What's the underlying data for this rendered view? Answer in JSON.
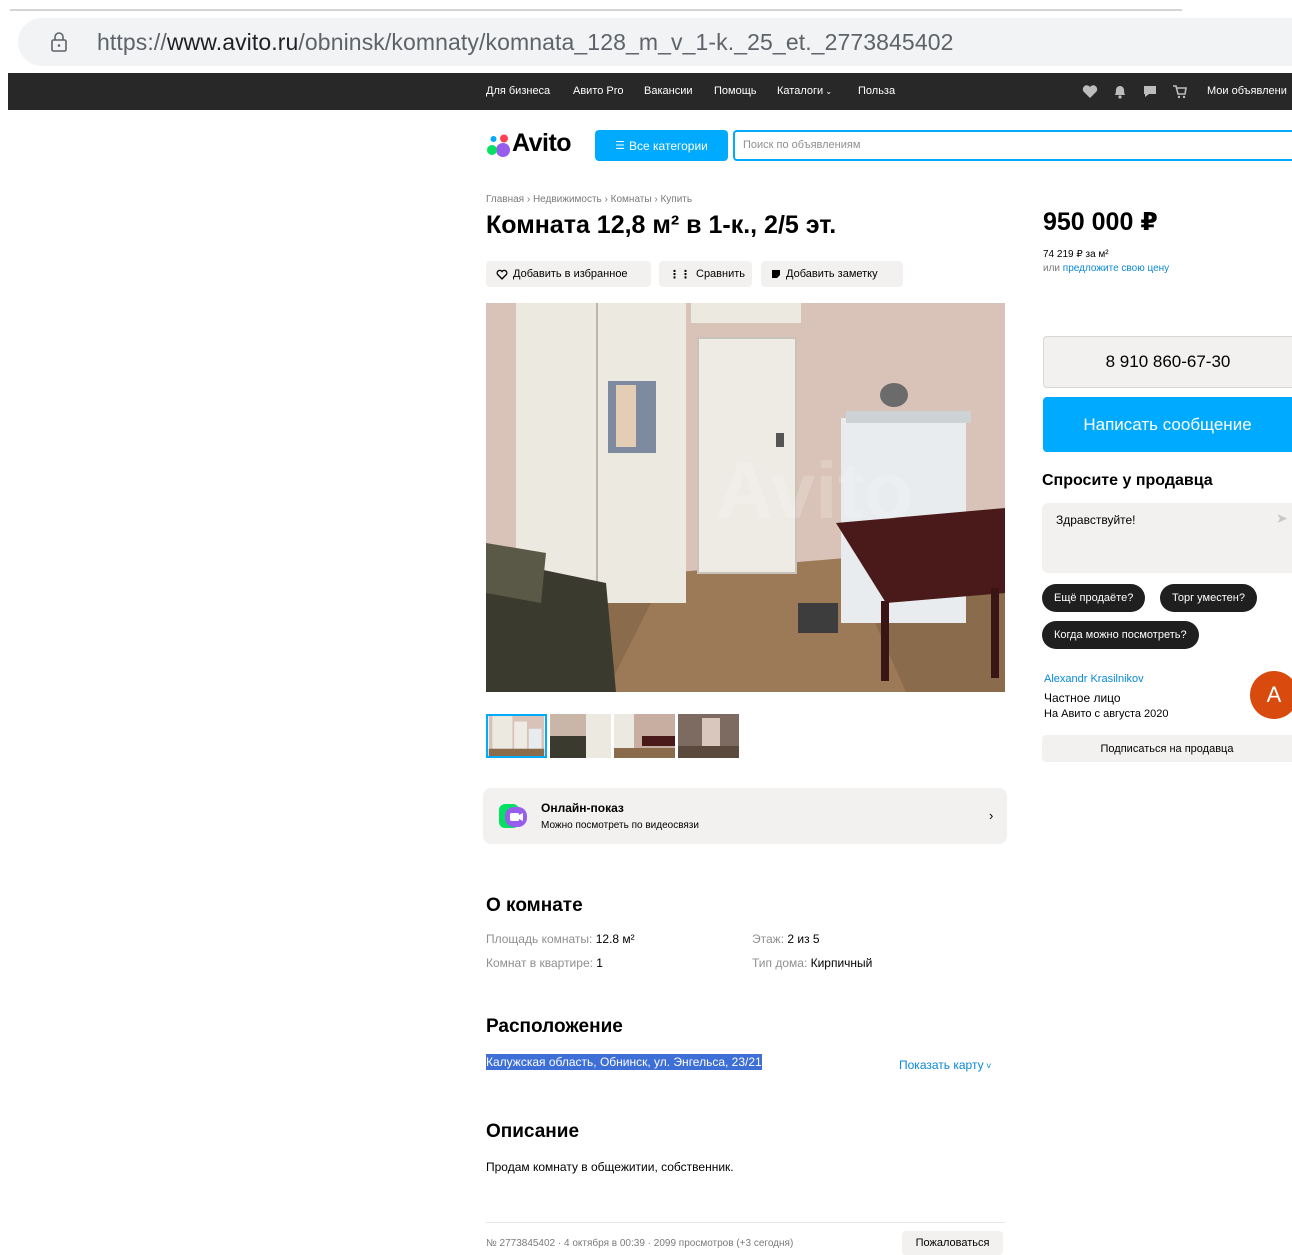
{
  "browser": {
    "url_prefix": "https://",
    "url_host": "www.avito.ru",
    "url_path": "/obninsk/komnaty/komnata_128_m_v_1-k._25_et._2773845402"
  },
  "topnav": {
    "links": [
      "Для бизнеса",
      "Авито Pro",
      "Вакансии",
      "Помощь",
      "Каталоги",
      "Польза"
    ],
    "my_ads": "Мои объявлени"
  },
  "header": {
    "logo": "Avito",
    "categories_button": "Все категории",
    "search_placeholder": "Поиск по объявлениям"
  },
  "breadcrumbs": [
    "Главная",
    "Недвижимость",
    "Комнаты",
    "Купить"
  ],
  "listing": {
    "title": "Комната 12,8 м² в 1-к., 2/5 эт.",
    "actions": {
      "favorite": "Добавить в избранное",
      "compare": "Сравнить",
      "note": "Добавить заметку"
    }
  },
  "online_show": {
    "title": "Онлайн-показ",
    "subtitle": "Можно посмотреть по видеосвязи"
  },
  "about": {
    "heading": "О комнате",
    "area_key": "Площадь комнаты: ",
    "area_val": "12.8 м²",
    "rooms_key": "Комнат в квартире: ",
    "rooms_val": "1",
    "floor_key": "Этаж: ",
    "floor_val": "2 из 5",
    "house_key": "Тип дома: ",
    "house_val": "Кирпичный"
  },
  "location": {
    "heading": "Расположение",
    "address": "Калужская область, Обнинск, ул. Энгельса, 23/21",
    "show_map": "Показать карту"
  },
  "description": {
    "heading": "Описание",
    "text": "Продам комнату в общежитии, собственник."
  },
  "footer": {
    "meta": "№ 2773845402 · 4 октября в 00:39 · 2099 просмотров (+3 сегодня)",
    "report": "Пожаловаться"
  },
  "sidebar": {
    "price": "950 000 ₽",
    "per_sqm": "74 219 ₽ за м²",
    "offer_prefix": "или ",
    "offer_link": "предложите свою цену",
    "phone": "8 910 860-67-30",
    "message_button": "Написать сообщение",
    "ask_heading": "Спросите у продавца",
    "ask_input": "Здравствуйте!",
    "chips": [
      "Ещё продаёте?",
      "Торг уместен?",
      "Когда можно посмотреть?"
    ],
    "seller_name": "Alexandr Krasilnikov",
    "seller_type": "Частное лицо",
    "seller_since": "На Авито с августа 2020",
    "avatar_letter": "A",
    "subscribe": "Подписаться на продавца"
  },
  "colors": {
    "accent": "#00aaff",
    "topbar": "#282828",
    "link": "#0a88d6",
    "avatar": "#d94a0e"
  }
}
